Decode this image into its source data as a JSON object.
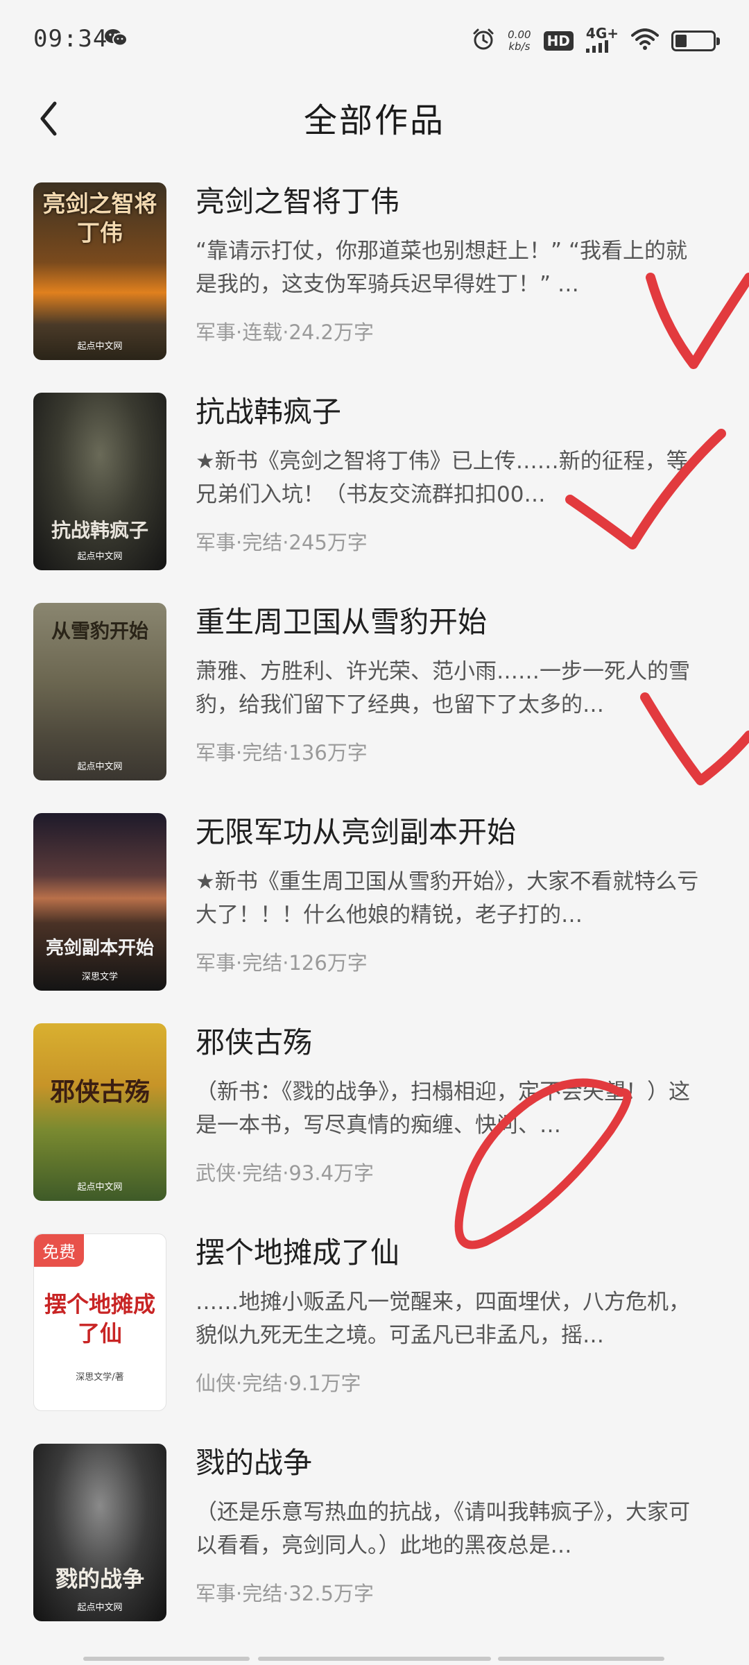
{
  "status_bar": {
    "time": "09:34",
    "speed_value": "0.00",
    "speed_unit": "kb/s",
    "hd": "HD",
    "network": "4G+"
  },
  "header": {
    "title": "全部作品"
  },
  "books": [
    {
      "title": "亮剑之智将丁伟",
      "desc": "“靠请示打仗，你那道菜也别想赶上！” “我看上的就是我的，这支伪军骑兵迟早得姓丁！” …",
      "meta": "军事·连载·24.2万字",
      "cover_title": "亮剑之智将丁伟",
      "cover_publisher": "起点中文网"
    },
    {
      "title": "抗战韩疯子",
      "desc": "★新书《亮剑之智将丁伟》已上传……新的征程，等兄弟们入坑！（书友交流群扣扣00…",
      "meta": "军事·完结·245万字",
      "cover_title": "抗战韩疯子",
      "cover_publisher": "起点中文网"
    },
    {
      "title": "重生周卫国从雪豹开始",
      "desc": "萧雅、方胜利、许光荣、范小雨……一步一死人的雪豹，给我们留下了经典，也留下了太多的…",
      "meta": "军事·完结·136万字",
      "cover_title": "从雪豹开始",
      "cover_publisher": "起点中文网"
    },
    {
      "title": "无限军功从亮剑副本开始",
      "desc": "★新书《重生周卫国从雪豹开始》，大家不看就特么亏大了！！！什么他娘的精锐，老子打的…",
      "meta": "军事·完结·126万字",
      "cover_title": "亮剑副本开始",
      "cover_publisher": "深思文学"
    },
    {
      "title": "邪侠古殇",
      "desc": "（新书：《戮的战争》，扫榻相迎，定不会失望！）这是一本书，写尽真情的痴缠、快问、…",
      "meta": "武侠·完结·93.4万字",
      "cover_title": "邪侠古殇",
      "cover_publisher": "起点中文网"
    },
    {
      "title": "摆个地摊成了仙",
      "desc": "……地摊小贩孟凡一觉醒来，四面埋伏，八方危机，貌似九死无生之境。可孟凡已非孟凡，摇…",
      "meta": "仙侠·完结·9.1万字",
      "cover_title": "摆个地摊成了仙",
      "cover_publisher": "深思文学/著",
      "badge": "免费"
    },
    {
      "title": "戮的战争",
      "desc": "（还是乐意写热血的抗战，《请叫我韩疯子》，大家可以看看，亮剑同人。）此地的黑夜总是…",
      "meta": "军事·完结·32.5万字",
      "cover_title": "戮的战争",
      "cover_publisher": "起点中文网"
    }
  ]
}
